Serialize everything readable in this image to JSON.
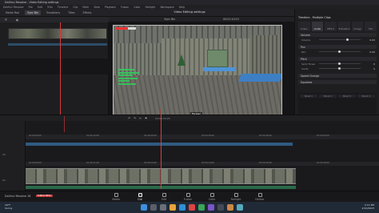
{
  "window": {
    "title": "DaVinci Resolve - Video Editing settings"
  },
  "menu": [
    "DaVinci Resolve",
    "File",
    "Edit",
    "Trim",
    "Timeline",
    "Clip",
    "Mark",
    "View",
    "Playback",
    "Fusion",
    "Color",
    "Fairlight",
    "Workspace",
    "Help"
  ],
  "toolbar": {
    "items": [
      "Media Pool",
      "Sync Bin",
      "Transitions",
      "Titles",
      "Effects"
    ],
    "active_index": 1,
    "page_title": "Video Editing settings",
    "right_items": [
      "Sound Library",
      "Inspector"
    ]
  },
  "viewer": {
    "label": "Sync Bin",
    "timecode_left": "00:01:10:23",
    "overlay_tag": "Ferasal",
    "timecode": "01:00:13:23",
    "controls": [
      "⏮",
      "◀",
      "■",
      "▶",
      "⏭",
      "⟳"
    ]
  },
  "inspector": {
    "title": "Timeline - Multiple Clips",
    "tabs": [
      "Video",
      "Audio",
      "Effect",
      "Transition",
      "Image",
      "File"
    ],
    "active_tab": 1,
    "sections": {
      "volume": "Volume",
      "pan": "Pan",
      "pitch": "Pitch",
      "speed": "Speed Change",
      "eq": "Equalizer"
    },
    "rows": {
      "volume_label": "Volume",
      "volume_value": "0.00",
      "pan_label": "Pan",
      "pan_value": "0.00",
      "semitones_label": "Semi Tones",
      "semitones_value": "0",
      "cents_label": "Cents",
      "cents_value": "0"
    },
    "eq_bands": [
      "Band 1",
      "Band 2",
      "Band 3",
      "Band 4"
    ]
  },
  "timeline": {
    "timecode_small": "01:00:13:23",
    "ruler_top": [
      "01:00:00:00",
      "01:00:10:00",
      "01:00:20:00",
      "01:00:30:00",
      "01:00:40:00",
      "01:00:50:00"
    ],
    "ruler_bottom": [
      "01:00:09:00",
      "01:00:11:00",
      "01:00:12:00",
      "01:00:14:00",
      "01:00:16:00",
      "01:00:18:00"
    ],
    "track_labels": [
      "V1",
      "A1"
    ]
  },
  "pages": {
    "items": [
      "Media",
      "Cut",
      "Edit",
      "Fusion",
      "Color",
      "Fairlight",
      "Deliver"
    ],
    "active_index": 1,
    "app_name": "DaVinci Resolve 18",
    "badge": "PUBLIC BETA"
  },
  "taskbar": {
    "weather_temp": "16°F",
    "weather_desc": "Sunny",
    "time": "2:11 PM",
    "date": "2/10/2023"
  }
}
